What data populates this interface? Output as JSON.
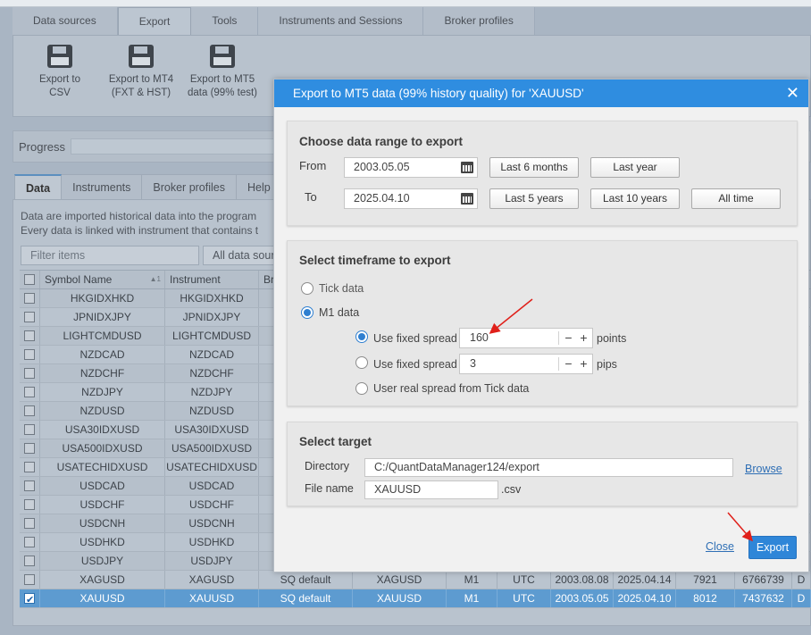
{
  "main_tabs": [
    "Data sources",
    "Export",
    "Tools",
    "Instruments and Sessions",
    "Broker profiles"
  ],
  "ribbon": {
    "csv": "Export to CSV",
    "mt4_l1": "Export to MT4",
    "mt4_l2": "(FXT & HST)",
    "mt5_l1": "Export to MT5",
    "mt5_l2": "data (99% test)"
  },
  "progress_label": "Progress",
  "sub_tabs": [
    "Data",
    "Instruments",
    "Broker profiles",
    "Help"
  ],
  "info": {
    "line1": "Data are imported historical data into the program",
    "line2": "Every data is linked with instrument that contains t"
  },
  "filter": {
    "placeholder": "Filter items",
    "all_sources": "All data sour"
  },
  "grid": {
    "headers": [
      "",
      "Symbol Name",
      "Instrument",
      "Br",
      "",
      "",
      "",
      "",
      "",
      "",
      "",
      ""
    ],
    "sort_indicator": "▲1",
    "rows": [
      [
        "HKGIDXHKD",
        "HKGIDXHKD",
        "",
        "",
        "",
        "",
        "",
        "",
        "",
        "",
        ""
      ],
      [
        "JPNIDXJPY",
        "JPNIDXJPY",
        "",
        "",
        "",
        "",
        "",
        "",
        "",
        "",
        ""
      ],
      [
        "LIGHTCMDUSD",
        "LIGHTCMDUSD",
        "",
        "",
        "",
        "",
        "",
        "",
        "",
        "",
        ""
      ],
      [
        "NZDCAD",
        "NZDCAD",
        "",
        "",
        "",
        "",
        "",
        "",
        "",
        "",
        ""
      ],
      [
        "NZDCHF",
        "NZDCHF",
        "",
        "",
        "",
        "",
        "",
        "",
        "",
        "",
        ""
      ],
      [
        "NZDJPY",
        "NZDJPY",
        "",
        "",
        "",
        "",
        "",
        "",
        "",
        "",
        ""
      ],
      [
        "NZDUSD",
        "NZDUSD",
        "",
        "",
        "",
        "",
        "",
        "",
        "",
        "",
        ""
      ],
      [
        "USA30IDXUSD",
        "USA30IDXUSD",
        "",
        "",
        "",
        "",
        "",
        "",
        "",
        "",
        ""
      ],
      [
        "USA500IDXUSD",
        "USA500IDXUSD",
        "",
        "",
        "",
        "",
        "",
        "",
        "",
        "",
        ""
      ],
      [
        "USATECHIDXUSD",
        "USATECHIDXUSD",
        "",
        "",
        "",
        "",
        "",
        "",
        "",
        "",
        ""
      ],
      [
        "USDCAD",
        "USDCAD",
        "",
        "",
        "",
        "",
        "",
        "",
        "",
        "",
        ""
      ],
      [
        "USDCHF",
        "USDCHF",
        "",
        "",
        "",
        "",
        "",
        "",
        "",
        "",
        ""
      ],
      [
        "USDCNH",
        "USDCNH",
        "",
        "",
        "",
        "",
        "",
        "",
        "",
        "",
        ""
      ],
      [
        "USDHKD",
        "USDHKD",
        "",
        "",
        "",
        "",
        "",
        "",
        "",
        "",
        ""
      ],
      [
        "USDJPY",
        "USDJPY",
        "",
        "",
        "",
        "",
        "",
        "",
        "",
        "",
        ""
      ],
      [
        "XAGUSD",
        "XAGUSD",
        "SQ default",
        "XAGUSD",
        "M1",
        "UTC",
        "2003.08.08",
        "2025.04.14",
        "7921",
        "6766739",
        "D"
      ],
      [
        "XAUUSD",
        "XAUUSD",
        "SQ default",
        "XAUUSD",
        "M1",
        "UTC",
        "2003.05.05",
        "2025.04.10",
        "8012",
        "7437632",
        "D"
      ]
    ]
  },
  "modal": {
    "title": "Export to MT5 data (99% history quality) for 'XAUUSD'",
    "close": "✕",
    "range": {
      "title": "Choose data range to export",
      "from_label": "From",
      "from_value": "2003.05.05",
      "to_label": "To",
      "to_value": "2025.04.10",
      "last_6_months": "Last 6 months",
      "last_year": "Last year",
      "last_5_years": "Last 5 years",
      "last_10_years": "Last 10 years",
      "all_time": "All time"
    },
    "timeframe": {
      "title": "Select timeframe to export",
      "tick": "Tick data",
      "m1": "M1 data",
      "spread_points_label": "Use fixed spread",
      "spread_points_value": "160",
      "points_unit": "points",
      "spread_pips_label": "Use fixed spread",
      "spread_pips_value": "3",
      "pips_unit": "pips",
      "real_spread": "User real spread from Tick data",
      "minus": "−",
      "plus": "+"
    },
    "target": {
      "title": "Select target",
      "dir_label": "Directory",
      "dir_value": "C:/QuantDataManager124/export",
      "browse": "Browse",
      "file_label": "File name",
      "file_value": "XAUUSD",
      "ext": ".csv"
    },
    "close_link": "Close",
    "export_button": "Export"
  },
  "colors": {
    "accent": "#2f8de0",
    "selected_row": "#5d9bd0",
    "annotation": "#e0201a"
  }
}
